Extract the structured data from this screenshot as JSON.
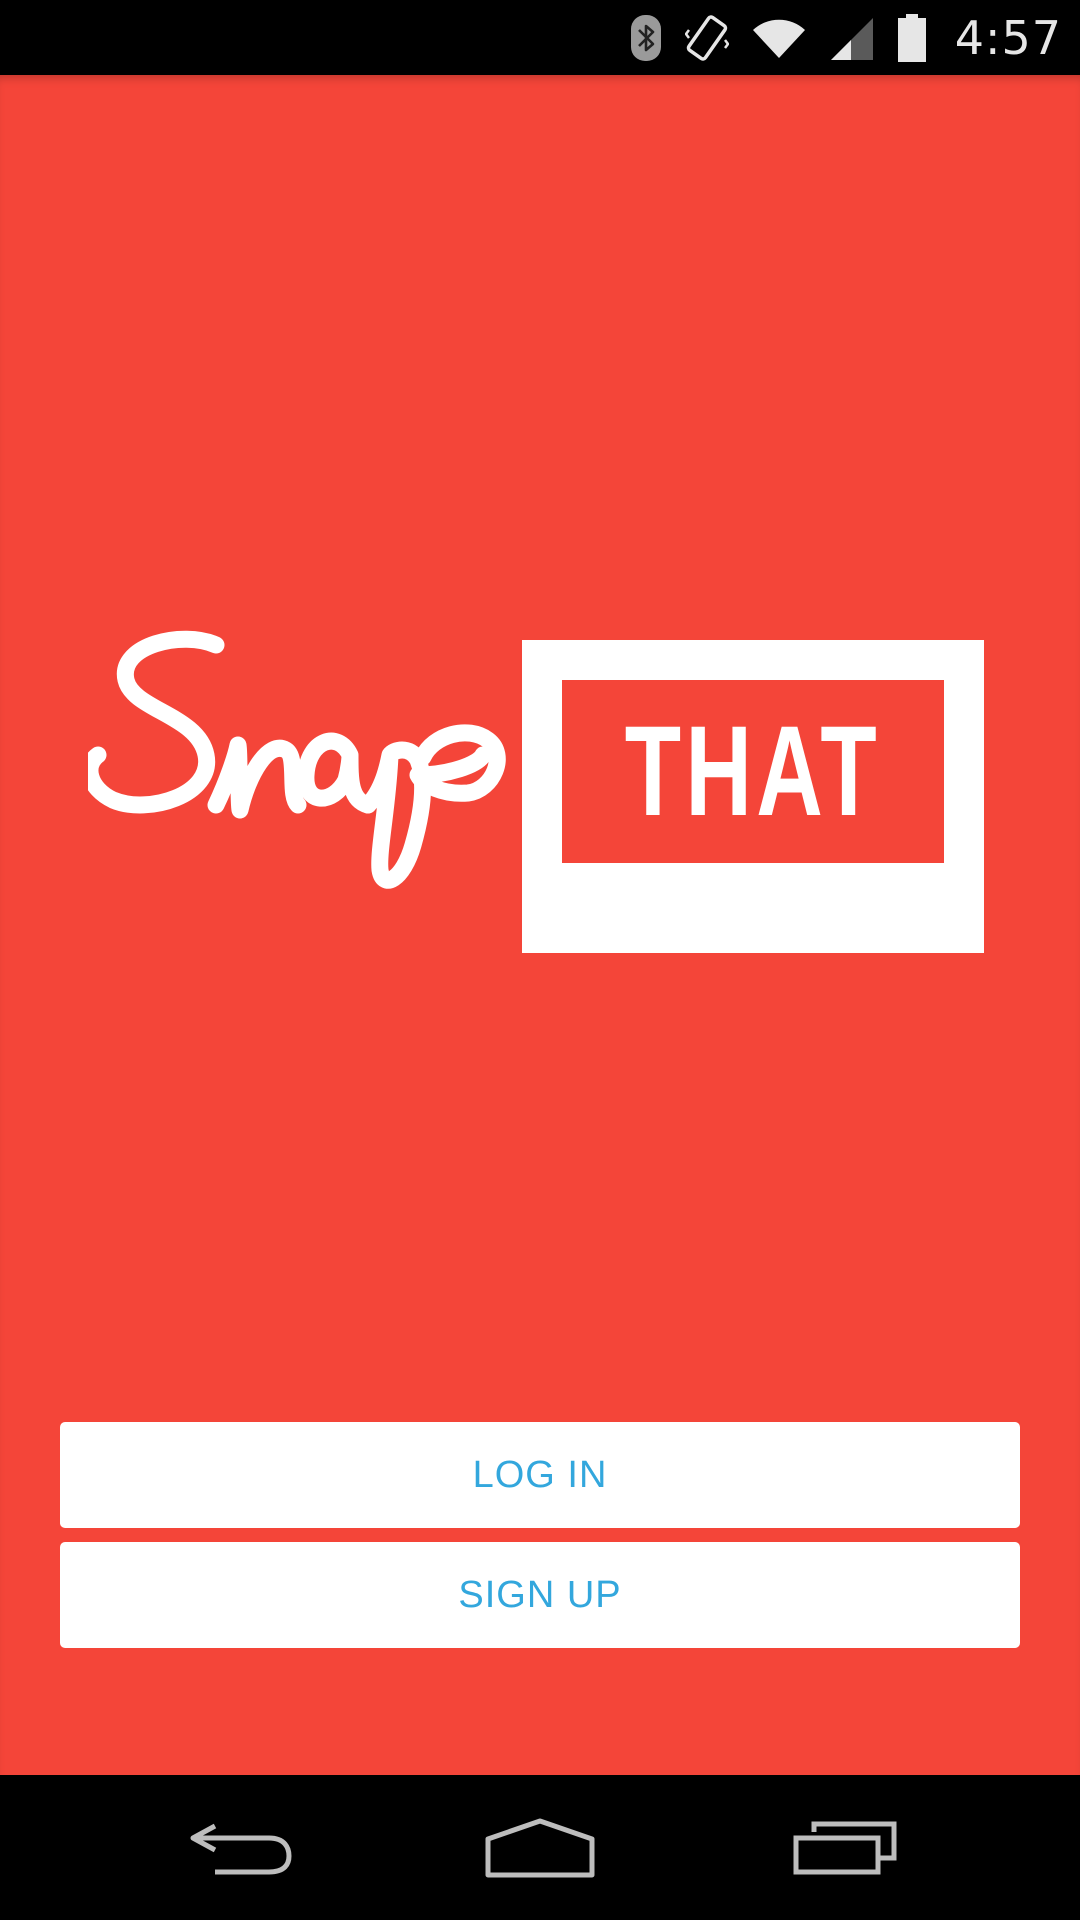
{
  "status_bar": {
    "time": "4:57",
    "icons": [
      "bluetooth-icon",
      "vibrate-icon",
      "wifi-icon",
      "signal-icon",
      "battery-icon"
    ]
  },
  "logo": {
    "script_text": "Snap",
    "frame_text": "THAT"
  },
  "buttons": {
    "login_label": "LOG IN",
    "signup_label": "SIGN UP"
  },
  "nav_bar": {
    "icons": [
      "back-icon",
      "home-icon",
      "recents-icon"
    ]
  },
  "colors": {
    "brand_red": "#f44539",
    "button_text_blue": "#33a7dd",
    "button_bg": "#ffffff"
  }
}
